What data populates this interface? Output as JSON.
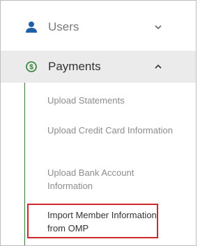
{
  "nav": {
    "users": {
      "label": "Users",
      "icon": "user-icon",
      "chevron": "chevron-down-icon",
      "expanded": false
    },
    "payments": {
      "label": "Payments",
      "icon": "dollar-circle-icon",
      "chevron": "chevron-up-icon",
      "expanded": true
    }
  },
  "submenu": {
    "items": [
      {
        "label": "Upload Statements"
      },
      {
        "label": "Upload Credit Card Information"
      },
      {
        "label": "Upload Bank Account Information"
      },
      {
        "label": "Import Member Information from OMP",
        "highlighted": true
      }
    ]
  },
  "colors": {
    "accent_blue": "#1f5fa8",
    "accent_green": "#2e7d32",
    "highlight_red": "#d0262e",
    "active_bg": "#ebebeb"
  }
}
